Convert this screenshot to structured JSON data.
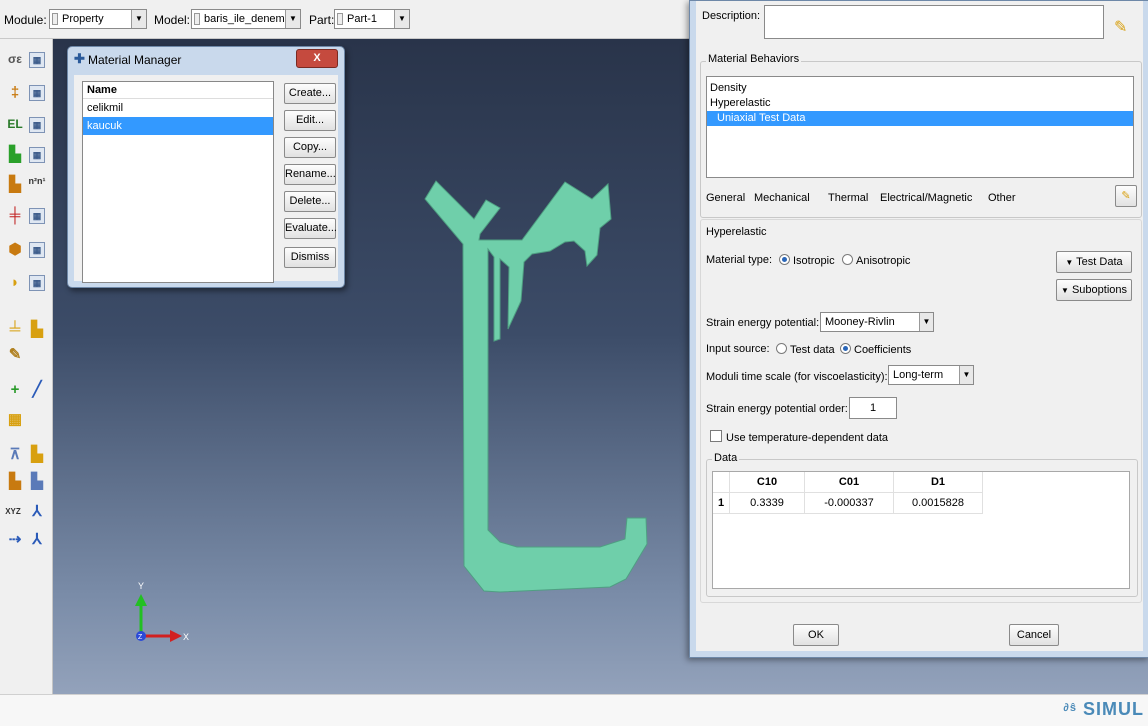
{
  "context_bar": {
    "module_label": "Module:",
    "module_value": "Property",
    "model_label": "Model:",
    "model_value": "baris_ile_deneme",
    "part_label": "Part:",
    "part_value": "Part-1"
  },
  "viewport": {
    "triad": {
      "y": "Y",
      "x": "X",
      "z": "Z"
    }
  },
  "toolbox": {
    "icons": [
      "material-create-icon",
      "section-create-icon",
      "assign-section-icon",
      "profile-icon",
      "orientation-icon",
      "skin-icon",
      "composite-layup-icon",
      "special-icon",
      "inertia-icon",
      "spring-icon",
      "datum-point-icon",
      "datum-axis-icon",
      "partition-icon",
      "query-icon",
      "csys-icon",
      "triad-icon"
    ],
    "triad_label_text": "XYZ"
  },
  "branding": {
    "text": "SIMUL"
  },
  "material_manager": {
    "title": "Material Manager",
    "close_label": "X",
    "column_header": "Name",
    "materials": [
      {
        "name": "celikmil",
        "selected": false
      },
      {
        "name": "kaucuk",
        "selected": true
      }
    ],
    "buttons": [
      "Create...",
      "Edit...",
      "Copy...",
      "Rename...",
      "Delete...",
      "Evaluate...",
      "Dismiss"
    ]
  },
  "edit_material": {
    "description_label": "Description:",
    "description_value": "",
    "behaviors_title": "Material Behaviors",
    "behaviors": [
      {
        "name": "Density",
        "selected": false
      },
      {
        "name": "Hyperelastic",
        "selected": false
      },
      {
        "name": "Uniaxial Test Data",
        "selected": true
      }
    ],
    "tabs": [
      "General",
      "Mechanical",
      "Thermal",
      "Electrical/Magnetic",
      "Other"
    ],
    "section_title": "Hyperelastic",
    "material_type_label": "Material type:",
    "material_type_options": [
      "Isotropic",
      "Anisotropic"
    ],
    "material_type_selected": "Isotropic",
    "test_data_button": "Test Data",
    "suboptions_button": "Suboptions",
    "strain_energy_label": "Strain energy potential:",
    "strain_energy_value": "Mooney-Rivlin",
    "input_source_label": "Input source:",
    "input_source_options": [
      "Test data",
      "Coefficients"
    ],
    "input_source_selected": "Coefficients",
    "moduli_label": "Moduli time scale (for viscoelasticity):",
    "moduli_value": "Long-term",
    "order_label": "Strain energy potential order:",
    "order_value": "1",
    "temp_dependent_label": "Use temperature-dependent data",
    "temp_dependent_checked": false,
    "data_title": "Data",
    "table": {
      "columns": [
        "C10",
        "C01",
        "D1"
      ],
      "rows": [
        {
          "index": "1",
          "values": [
            "0.3339",
            "-0.000337",
            "0.0015828"
          ]
        }
      ]
    },
    "ok_label": "OK",
    "cancel_label": "Cancel"
  },
  "colors": {
    "part_fill": "#6fcfaa",
    "selection": "#3399ff",
    "viewport_top": "#29344a",
    "viewport_bottom": "#93a2bb"
  }
}
